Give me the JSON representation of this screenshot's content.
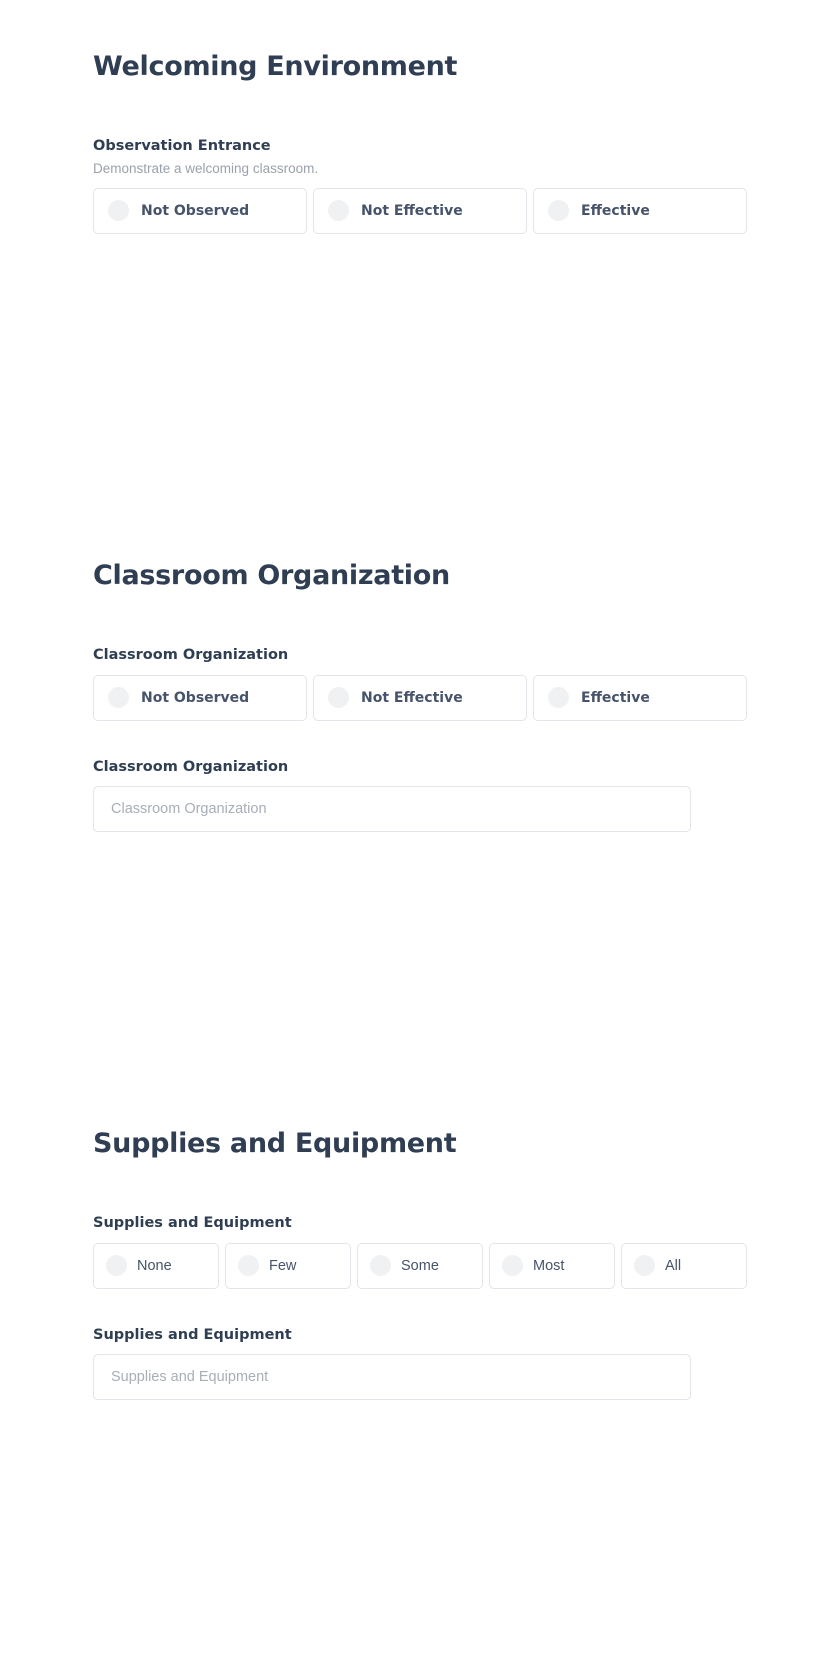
{
  "sections": [
    {
      "id": "welcoming-environment",
      "title": "Welcoming Environment",
      "fields": [
        {
          "id": "observation-entrance",
          "type": "radio-group",
          "label": "Observation Entrance",
          "help": "Demonstrate a welcoming classroom.",
          "options": [
            "Not Observed",
            "Not Effective",
            "Effective"
          ],
          "selected": null
        }
      ]
    },
    {
      "id": "classroom-organization",
      "title": "Classroom Organization",
      "fields": [
        {
          "id": "classroom-organization-rating",
          "type": "radio-group",
          "label": "Classroom Organization",
          "help": "",
          "options": [
            "Not Observed",
            "Not Effective",
            "Effective"
          ],
          "selected": null
        },
        {
          "id": "classroom-organization-notes",
          "type": "text",
          "label": "Classroom Organization",
          "placeholder": "Classroom Organization",
          "value": ""
        }
      ]
    },
    {
      "id": "supplies-and-equipment",
      "title": "Supplies and Equipment",
      "fields": [
        {
          "id": "supplies-and-equipment-rating",
          "type": "radio-group",
          "label": "Supplies and Equipment",
          "help": "",
          "options": [
            "None",
            "Few",
            "Some",
            "Most",
            "All"
          ],
          "selected": null
        },
        {
          "id": "supplies-and-equipment-notes",
          "type": "text",
          "label": "Supplies and Equipment",
          "placeholder": "Supplies and Equipment",
          "value": ""
        }
      ]
    }
  ],
  "colors": {
    "heading": "#2f3e53",
    "body_text": "#46536a",
    "help_text": "#9aa1ab",
    "placeholder": "#a8aeb8",
    "border": "#e2e5e9",
    "radio_fill": "#f0f1f3",
    "background": "#ffffff"
  }
}
